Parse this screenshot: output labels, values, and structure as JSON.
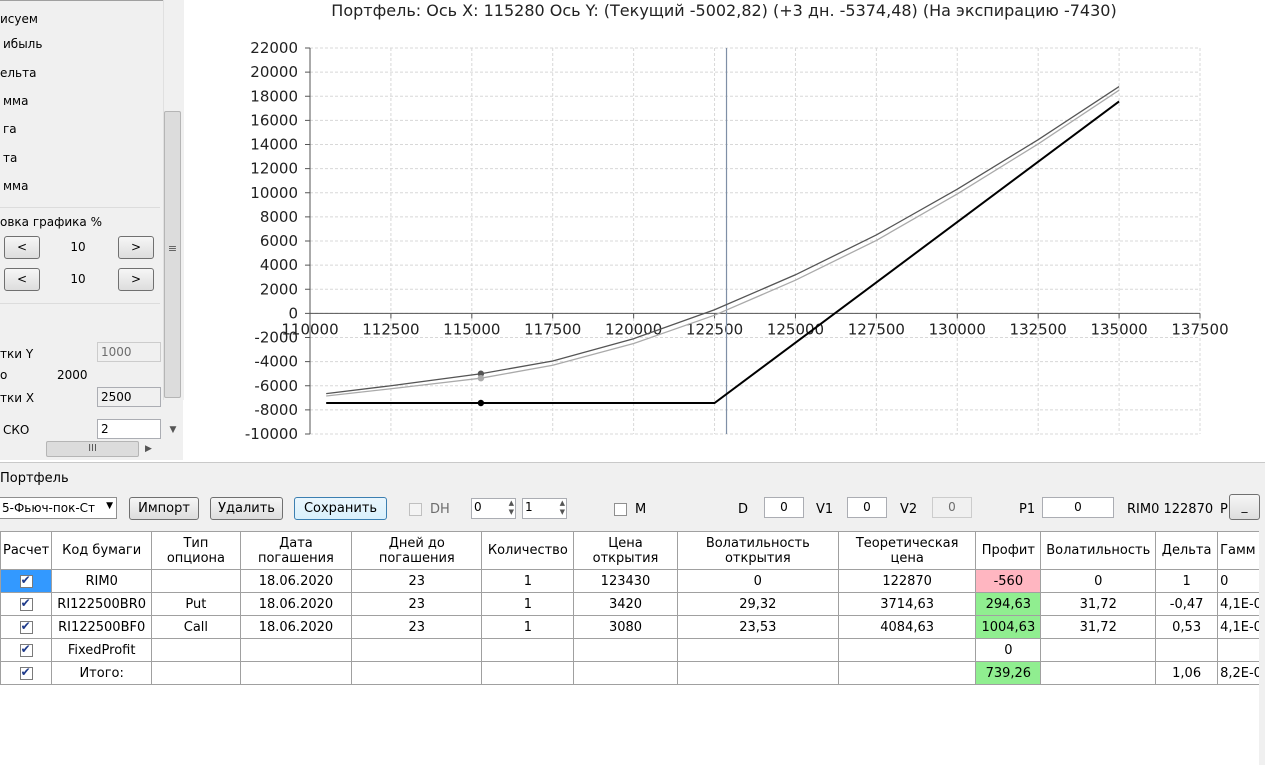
{
  "left_panel": {
    "group_draw_label": "исуем",
    "draw_items": [
      "ибыль",
      "ельта",
      "мма",
      "га",
      "та",
      "мма"
    ],
    "scale_label": "овка графика %",
    "scale_rows": [
      {
        "left_button": "<",
        "value": "10",
        "right_button": ">"
      },
      {
        "left_button": "<",
        "value": "10",
        "right_button": ">"
      }
    ],
    "step_y_label": "тки Y",
    "step_y_value": "1000",
    "o_label": "о",
    "o_value": "2000",
    "step_x_label": "тки X",
    "step_x_value": "2500",
    "sko_label": "СКО",
    "sko_value": "2",
    "hscroll_grip": "III",
    "vscroll_grip": "≡"
  },
  "chart": {
    "title": "Портфель: Ось X: 115280 Ось Y:  (Текущий -5002,82)  (+3 дн. -5374,48)  (На экспирацию -7430)"
  },
  "chart_data": {
    "type": "line",
    "title": "Портфель: Ось X: 115280 Ось Y:  (Текущий -5002,82)  (+3 дн. -5374,48)  (На экспирацию -7430)",
    "xlabel": "",
    "ylabel": "",
    "xlim": [
      110000,
      137500
    ],
    "ylim": [
      -10000,
      22000
    ],
    "x_ticks": [
      "110000",
      "112500",
      "115000",
      "117500",
      "120000",
      "122500",
      "125000",
      "127500",
      "130000",
      "132500",
      "135000",
      "137500"
    ],
    "y_ticks": [
      "22000",
      "20000",
      "18000",
      "16000",
      "14000",
      "12000",
      "10000",
      "8000",
      "6000",
      "4000",
      "2000",
      "0",
      "-2000",
      "-4000",
      "-6000",
      "-8000",
      "-10000"
    ],
    "grid": true,
    "cursor_x": 122870,
    "series": [
      {
        "color": "#555555",
        "x": [
          110500,
          112500,
          115280,
          117500,
          120000,
          122500,
          125000,
          127500,
          130000,
          132500,
          135000
        ],
        "y": [
          -6650,
          -6000,
          -5003,
          -3950,
          -2100,
          300,
          3200,
          6500,
          10300,
          14400,
          18800
        ]
      },
      {
        "color": "#aaaaaa",
        "x": [
          110500,
          112500,
          115280,
          117500,
          120000,
          122500,
          125000,
          127500,
          130000,
          132500,
          135000
        ],
        "y": [
          -6850,
          -6250,
          -5374,
          -4300,
          -2500,
          -150,
          2750,
          6050,
          9900,
          14050,
          18500
        ]
      },
      {
        "color": "#000000",
        "x": [
          110500,
          115280,
          122500,
          135000
        ],
        "y": [
          -7430,
          -7430,
          -7430,
          17570
        ]
      }
    ],
    "markers": [
      {
        "x": 115280,
        "y": -5003,
        "color": "#555555"
      },
      {
        "x": 115280,
        "y": -5374,
        "color": "#aaaaaa"
      },
      {
        "x": 115280,
        "y": -7430,
        "color": "#000000"
      }
    ]
  },
  "portfolio": {
    "group_label": "Портфель",
    "portfolio_select": "5-Фьюч-пок-Ст",
    "import_button": "Импорт",
    "delete_button": "Удалить",
    "save_button": "Сохранить",
    "dh_label": "DH",
    "spin1_value": "0",
    "spin2_value": "1",
    "m_label": "M",
    "d_label": "D",
    "d_value": "0",
    "v1_label": "V1",
    "v1_value": "0",
    "v2_label": "V2",
    "v2_value": "0",
    "p1_label": "P1",
    "p1_value": "0",
    "rim_label": "RIM0 122870",
    "p_label": "P",
    "small_button": "_"
  },
  "table": {
    "headers": [
      "Расчет",
      "Код бумаги",
      "Тип опциона",
      "Дата погашения",
      "Дней до погашения",
      "Количество",
      "Цена открытия",
      "Волатильность открытия",
      "Теоретическая цена",
      "Профит",
      "Волатильность",
      "Дельта",
      "Гамм"
    ],
    "rows": [
      {
        "code": "RIM0",
        "type": "",
        "date": "18.06.2020",
        "days": "23",
        "qty": "1",
        "price": "123430",
        "vol_open": "0",
        "theor": "122870",
        "profit": "-560",
        "profit_status": "neg",
        "vol": "0",
        "delta": "1",
        "gamma": "0"
      },
      {
        "code": "RI122500BR0",
        "type": "Put",
        "date": "18.06.2020",
        "days": "23",
        "qty": "1",
        "price": "3420",
        "vol_open": "29,32",
        "theor": "3714,63",
        "profit": "294,63",
        "profit_status": "pos",
        "vol": "31,72",
        "delta": "-0,47",
        "gamma": "4,1E-0"
      },
      {
        "code": "RI122500BF0",
        "type": "Call",
        "date": "18.06.2020",
        "days": "23",
        "qty": "1",
        "price": "3080",
        "vol_open": "23,53",
        "theor": "4084,63",
        "profit": "1004,63",
        "profit_status": "pos",
        "vol": "31,72",
        "delta": "0,53",
        "gamma": "4,1E-0"
      },
      {
        "code": "FixedProfit",
        "type": "",
        "date": "",
        "days": "",
        "qty": "",
        "price": "",
        "vol_open": "",
        "theor": "",
        "profit": "0",
        "profit_status": "",
        "vol": "",
        "delta": "",
        "gamma": ""
      },
      {
        "code": "Итого:",
        "type": "",
        "date": "",
        "days": "",
        "qty": "",
        "price": "",
        "vol_open": "",
        "theor": "",
        "profit": "739,26",
        "profit_status": "pos",
        "vol": "",
        "delta": "1,06",
        "gamma": "8,2E-0"
      }
    ]
  }
}
